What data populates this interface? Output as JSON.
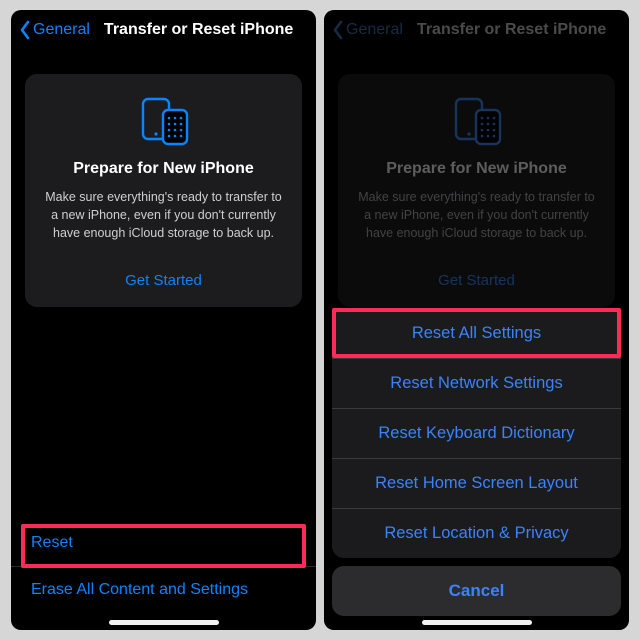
{
  "nav": {
    "back_label": "General",
    "title": "Transfer or Reset iPhone"
  },
  "card": {
    "title": "Prepare for New iPhone",
    "body": "Make sure everything's ready to transfer to a new iPhone, even if you don't currently have enough iCloud storage to back up.",
    "cta": "Get Started"
  },
  "rows": {
    "reset": "Reset",
    "erase": "Erase All Content and Settings"
  },
  "sheet": {
    "reset_all": "Reset All Settings",
    "network": "Reset Network Settings",
    "keyboard": "Reset Keyboard Dictionary",
    "home": "Reset Home Screen Layout",
    "location": "Reset Location & Privacy",
    "cancel": "Cancel"
  },
  "colors": {
    "accent": "#0a84ff",
    "highlight": "#ff2b55"
  }
}
